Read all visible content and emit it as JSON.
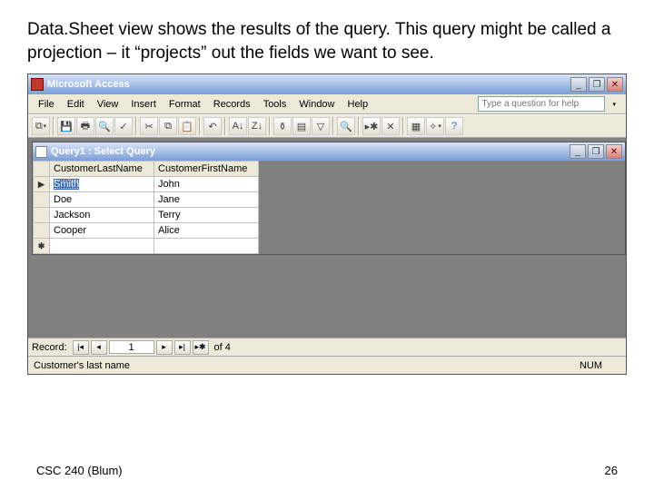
{
  "slide": {
    "title": "Data.Sheet view shows the results of the query. This query might be called a projection – it “projects” out the fields we want to see."
  },
  "app": {
    "title": "Microsoft Access",
    "helpPlaceholder": "Type a question for help"
  },
  "menu": {
    "file": "File",
    "edit": "Edit",
    "view": "View",
    "insert": "Insert",
    "format": "Format",
    "records": "Records",
    "tools": "Tools",
    "window": "Window",
    "help": "Help"
  },
  "child": {
    "title": "Query1 : Select Query"
  },
  "columns": {
    "c0": "CustomerLastName",
    "c1": "CustomerFirstName"
  },
  "rows": [
    {
      "last": "Smith",
      "first": "John"
    },
    {
      "last": "Doe",
      "first": "Jane"
    },
    {
      "last": "Jackson",
      "first": "Terry"
    },
    {
      "last": "Cooper",
      "first": "Alice"
    }
  ],
  "nav": {
    "label": "Record:",
    "current": "1",
    "of": "of  4"
  },
  "status": {
    "left": "Customer's last name",
    "right": "NUM"
  },
  "footer": {
    "left": "CSC 240 (Blum)",
    "right": "26"
  },
  "glyph": {
    "min": "_",
    "max": "❐",
    "restore": "❐",
    "close": "✕",
    "first": "|◂",
    "prev": "◂",
    "next": "▸",
    "last": "▸|",
    "new": "▸✱",
    "tri": "▶",
    "star": "✱",
    "dd": "▾"
  }
}
